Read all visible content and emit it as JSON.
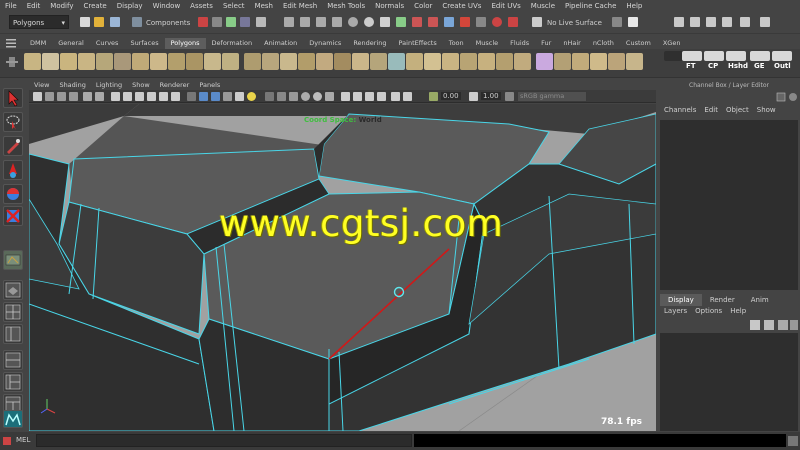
{
  "menubar": [
    "File",
    "Edit",
    "Modify",
    "Create",
    "Display",
    "Window",
    "Assets",
    "Select",
    "Mesh",
    "Edit Mesh",
    "Mesh Tools",
    "Normals",
    "Color",
    "Create UVs",
    "Edit UVs",
    "Muscle",
    "Pipeline Cache",
    "Help"
  ],
  "status": {
    "mode_dropdown": "Polygons",
    "components_label": "Components",
    "live_surface": "No Live Surface"
  },
  "shelf_tabs": [
    "DMM",
    "General",
    "Curves",
    "Surfaces",
    "Polygons",
    "Deformation",
    "Animation",
    "Dynamics",
    "Rendering",
    "PaintEffects",
    "Toon",
    "Muscle",
    "Fluids",
    "Fur",
    "nHair",
    "nCloth",
    "Custom",
    "XGen"
  ],
  "shelf_active": "Polygons",
  "shelf_labels": [
    "FT",
    "CP",
    "Hshd",
    "GE",
    "Outl"
  ],
  "panel_menu": [
    "View",
    "Shading",
    "Lighting",
    "Show",
    "Renderer",
    "Panels"
  ],
  "panel_bar": {
    "exposure": "0.00",
    "gamma": "1.00",
    "color_space": "sRGB gamma"
  },
  "viewport": {
    "coord_label": "Coord Space:",
    "coord_value": "World",
    "fps": "78.1 fps",
    "watermark": "www.cgtsj.com"
  },
  "channel_box": {
    "title": "Channel Box / Layer Editor",
    "menu": [
      "Channels",
      "Edit",
      "Object",
      "Show"
    ]
  },
  "layer_editor": {
    "tabs": [
      "Display",
      "Render",
      "Anim"
    ],
    "active_tab": "Display",
    "menu": [
      "Layers",
      "Options",
      "Help"
    ]
  },
  "command_line": {
    "label": "MEL"
  },
  "colors": {
    "wire": "#49d6e8",
    "selected_edge": "#d11818",
    "watermark": "#ffff24",
    "coord_label": "#3fbf3f"
  }
}
